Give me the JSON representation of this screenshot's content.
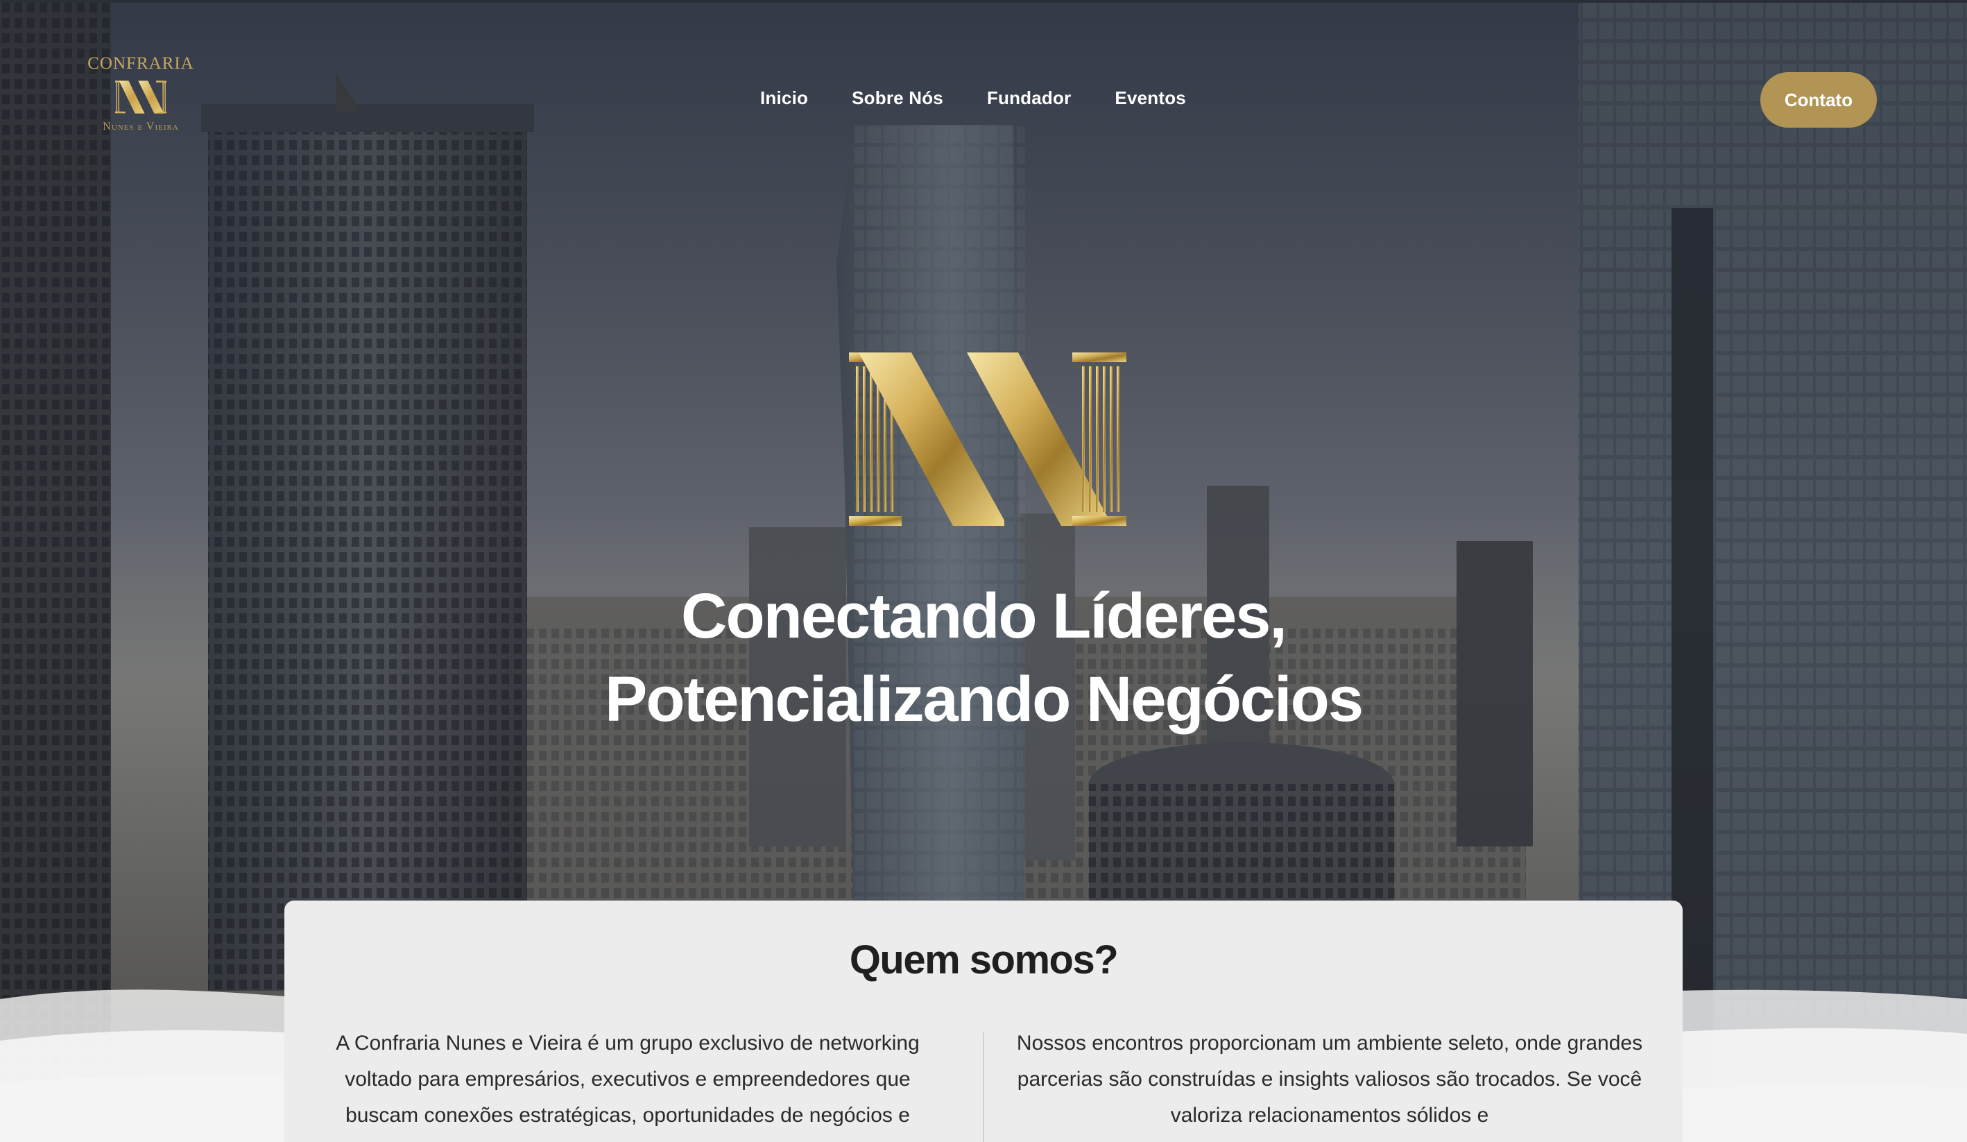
{
  "logo": {
    "top_text": "CONFRARIA",
    "bottom_text": "Nunes e Vieira",
    "mark_icon": "nv-pillar-logo-icon"
  },
  "nav": {
    "items": [
      "Inicio",
      "Sobre Nós",
      "Fundador",
      "Eventos"
    ]
  },
  "header": {
    "contact_label": "Contato"
  },
  "hero": {
    "title_line1": "Conectando Líderes,",
    "title_line2": "Potencializando Negócios",
    "mark_icon": "nv-pillar-logo-icon"
  },
  "about": {
    "heading": "Quem somos?",
    "left_text": "A Confraria Nunes e Vieira é um grupo exclusivo de networking voltado para empresários, executivos e empreendedores que buscam conexões estratégicas, oportunidades de negócios e",
    "right_text": "Nossos encontros proporcionam um ambiente seleto, onde grandes parcerias são construídas e insights valiosos são trocados. Se você valoriza relacionamentos sólidos e"
  },
  "colors": {
    "gold": "#b29555",
    "gold_light": "#f2dc8c",
    "gold_dark": "#9c7a2c",
    "white": "#ffffff",
    "card_bg": "#ececec",
    "text_dark": "#1f1f1f"
  }
}
